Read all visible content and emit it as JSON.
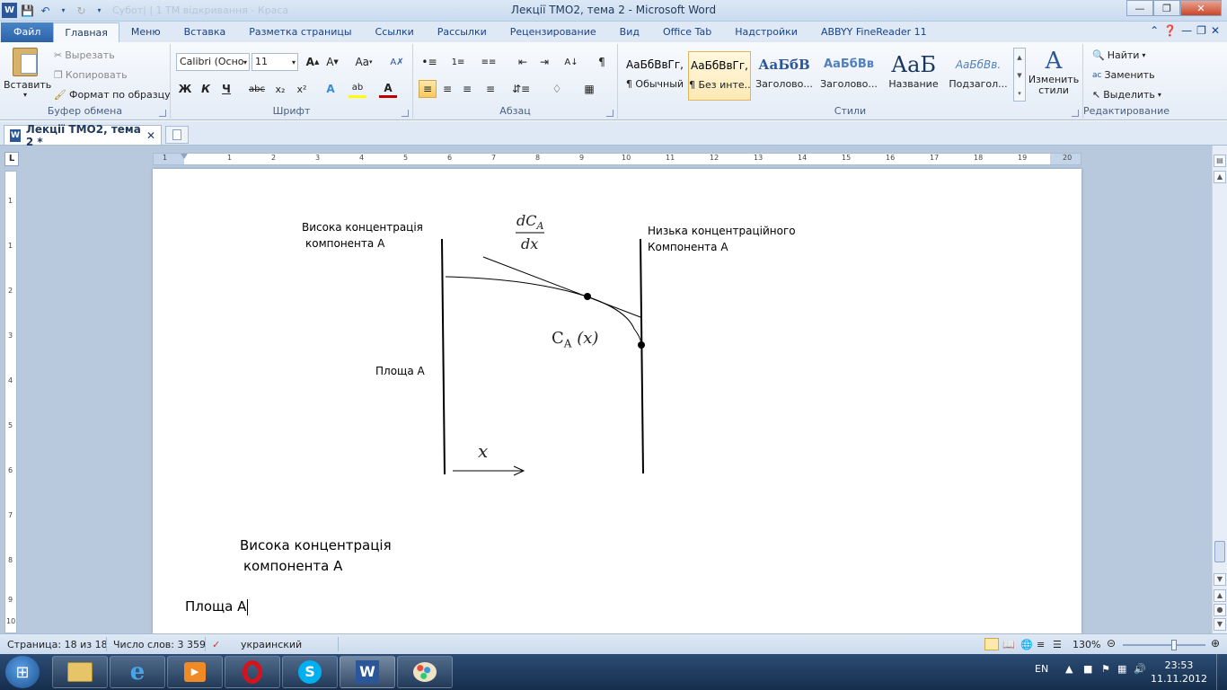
{
  "window": {
    "title": "Лекції ТМО2, тема 2  -  Microsoft Word",
    "ghost_title": "Субот| | 1 ТМ відкривання - Краса"
  },
  "ribbon_tabs": [
    {
      "label": "Файл"
    },
    {
      "label": "Главная"
    },
    {
      "label": "Меню"
    },
    {
      "label": "Вставка"
    },
    {
      "label": "Разметка страницы"
    },
    {
      "label": "Ссылки"
    },
    {
      "label": "Рассылки"
    },
    {
      "label": "Рецензирование"
    },
    {
      "label": "Вид"
    },
    {
      "label": "Office Tab"
    },
    {
      "label": "Надстройки"
    },
    {
      "label": "ABBYY FineReader 11"
    }
  ],
  "clipboard": {
    "paste": "Вставить",
    "cut": "Вырезать",
    "copy": "Копировать",
    "format_painter": "Формат по образцу",
    "group": "Буфер обмена"
  },
  "font": {
    "name": "Calibri (Осно",
    "size": "11",
    "group": "Шрифт",
    "bold": "Ж",
    "italic": "К",
    "underline": "Ч",
    "strike": "abc",
    "sub": "x₂",
    "sup": "x²"
  },
  "paragraph": {
    "group": "Абзац"
  },
  "styles": {
    "group": "Стили",
    "items": [
      {
        "preview": "АаБбВвГг,",
        "name": "¶ Обычный"
      },
      {
        "preview": "АаБбВвГг,",
        "name": "¶ Без инте..."
      },
      {
        "preview": "АаБбВ",
        "name": "Заголово..."
      },
      {
        "preview": "АаБбВв",
        "name": "Заголово..."
      },
      {
        "preview": "АаБ",
        "name": "Название"
      },
      {
        "preview": "АаБбВв.",
        "name": "Подзагол..."
      }
    ],
    "change": "Изменить стили"
  },
  "editing": {
    "find": "Найти",
    "replace": "Заменить",
    "select": "Выделить",
    "group": "Редактирование"
  },
  "doc_tab": {
    "label": "Лекції ТМО2, тема 2 *"
  },
  "ruler": {
    "h_labels": [
      "1",
      "1",
      "2",
      "3",
      "4",
      "5",
      "6",
      "7",
      "8",
      "9",
      "10",
      "11",
      "12",
      "13",
      "14",
      "15",
      "16",
      "17",
      "18",
      "19",
      "20"
    ],
    "v_labels": [
      "1",
      "1",
      "2",
      "3",
      "4",
      "5",
      "6",
      "7",
      "8",
      "9",
      "10"
    ]
  },
  "document": {
    "figure": {
      "high_conc": "Висока концентрація",
      "component_a": "компонента А",
      "low_conc": "Низька концентраційного",
      "component_a2": "Компонента А",
      "area": "Площа А",
      "deriv_num_d": "d",
      "deriv_num_c": "C",
      "deriv_num_sub": "A",
      "deriv_den": "dx",
      "ca_c": "C",
      "ca_sub": "A",
      "ca_arg": "(x)",
      "x_axis": "x"
    },
    "body": {
      "line1": "Висока концентрація",
      "line2": "компонента А",
      "line3": "Площа А"
    }
  },
  "status": {
    "page": "Страница: 18 из 18",
    "words": "Число слов: 3 359",
    "lang": "украинский",
    "zoom": "130%",
    "zoom_level": 0.62
  },
  "taskbar": {
    "lang": "EN",
    "time": "23:53",
    "date": "11.11.2012"
  }
}
